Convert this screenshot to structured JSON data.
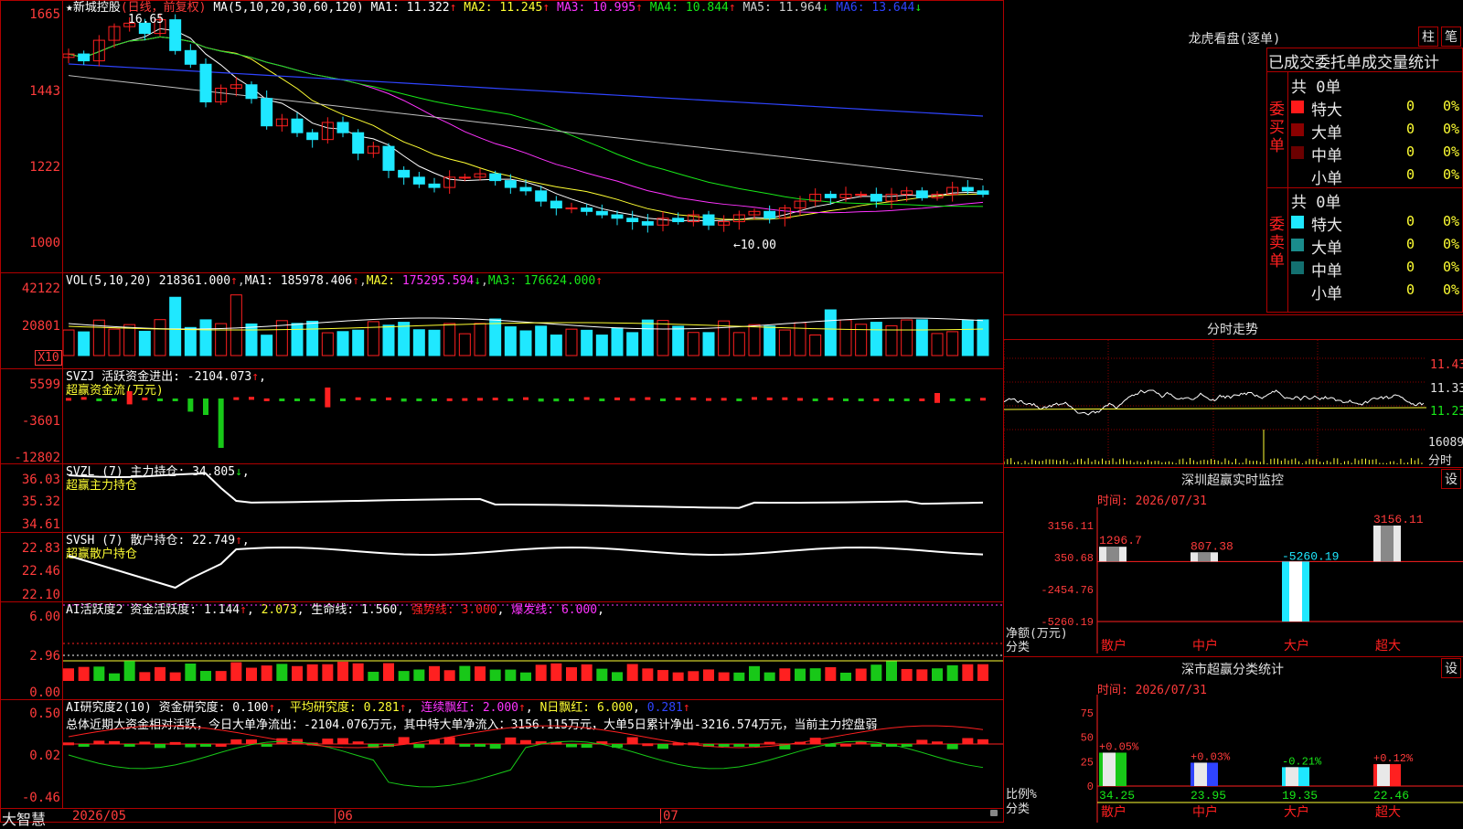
{
  "colors": {
    "up": "#ff2020",
    "down": "#1fe8ff",
    "green": "#18c818",
    "border": "#b00000",
    "axis": "#ff3b3b",
    "yellow": "#ffff33",
    "magenta": "#ff33ff",
    "blue": "#2f44ff",
    "gray": "#c0c0c0"
  },
  "main": {
    "star": "★",
    "title": "新城控股",
    "mode": "(日线，前复权)",
    "ma_label": "MA(5,10,20,30,60,120)",
    "ma": [
      {
        "name": "MA1",
        "val": "11.322",
        "arrow": "↑",
        "color": "#ffffff"
      },
      {
        "name": "MA2",
        "val": "11.245",
        "arrow": "↑",
        "color": "#ffff33"
      },
      {
        "name": "MA3",
        "val": "10.995",
        "arrow": "↑",
        "color": "#ff33ff"
      },
      {
        "name": "MA4",
        "val": "10.844",
        "arrow": "↑",
        "color": "#18e818"
      },
      {
        "name": "MA5",
        "val": "11.964",
        "arrow": "↓",
        "color": "#d0d0d0"
      },
      {
        "name": "MA6",
        "val": "13.644",
        "arrow": "↓",
        "color": "#2f44ff"
      }
    ],
    "high_note": "16.65",
    "low_note": "←10.00",
    "yticks": [
      "1665",
      "1443",
      "1222",
      "1000"
    ]
  },
  "vol": {
    "label": "VOL(5,10,20)",
    "val": "218361.000",
    "ma1": "185978.406",
    "ma2": "175295.594",
    "ma3": "176624.000",
    "arrows": [
      "↑",
      "↑",
      "↓",
      "↑"
    ],
    "yticks": [
      "42122",
      "20801"
    ],
    "unit": "X10"
  },
  "svzj": {
    "label": "SVZJ  活跃资金进出:",
    "val": "-2104.073",
    "sub": "超赢资金流(万元)",
    "yticks": [
      "5599",
      "-3601",
      "-12802"
    ]
  },
  "svzl": {
    "label": "SVZL (7) 主力持仓:",
    "val": "34.805",
    "arrow": "↓",
    "sub": "超赢主力持仓",
    "yticks": [
      "36.03",
      "35.32",
      "34.61"
    ]
  },
  "svsh": {
    "label": "SVSH (7) 散户持仓:",
    "val": "22.749",
    "arrow": "↑",
    "sub": "超赢散户持仓",
    "yticks": [
      "22.83",
      "22.46",
      "22.10"
    ]
  },
  "ai1": {
    "label": "AI活跃度2 资金活跃度:",
    "v1": "1.144",
    "v2": "2.073",
    "life": "生命线:",
    "v3": "1.560",
    "strong": "强势线:",
    "v4": "3.000",
    "burst": "爆发线:",
    "v5": "6.000",
    "yticks": [
      "6.00",
      "2.96",
      "0.00"
    ]
  },
  "ai2": {
    "label": "AI研究度2(10) 资金研究度:",
    "v1": "0.100",
    "avg": "平均研究度:",
    "v2": "0.281",
    "cont": "连续飘红:",
    "v3": "2.000",
    "nday": "N日飘红:",
    "v4": "6.000",
    "v5": "0.281",
    "summary": "总体近期大资金相对活跃，今日大单净流出：-2104.076万元，其中特大单净流入：3156.115万元，大单5日累计净出-3216.574万元，当前主力控盘弱",
    "yticks": [
      "0.50",
      "0.02",
      "-0.46"
    ]
  },
  "footer": {
    "brand": "大智慧",
    "d1": "2026/05",
    "d2": "06",
    "d3": "07"
  },
  "right": {
    "lhb_title": "龙虎看盘(逐单)",
    "btn1": "柱",
    "btn2": "笔",
    "tab_header": "已成交委托单成交量统计",
    "buy_side": "委买单",
    "sell_side": "委卖单",
    "buy_total": "共 0单",
    "sell_total": "共 0单",
    "rows": [
      {
        "label": "特大",
        "count": "0",
        "pct": "0%",
        "color": "#ff1a1a"
      },
      {
        "label": "大单",
        "count": "0",
        "pct": "0%",
        "color": "#8b0000"
      },
      {
        "label": "中单",
        "count": "0",
        "pct": "0%",
        "color": "#6b0000"
      },
      {
        "label": "小单",
        "count": "0",
        "pct": "0%",
        "color": "#000000"
      }
    ],
    "sell_rows": [
      {
        "label": "特大",
        "count": "0",
        "pct": "0%",
        "color": "#1fe8ff"
      },
      {
        "label": "大单",
        "count": "0",
        "pct": "0%",
        "color": "#1a8c8c"
      },
      {
        "label": "中单",
        "count": "0",
        "pct": "0%",
        "color": "#137070"
      },
      {
        "label": "小单",
        "count": "0",
        "pct": "0%",
        "color": "#000000"
      }
    ],
    "fs_title": "分时走势",
    "fs_y": [
      "11.43",
      "11.33",
      "11.23",
      "16089"
    ],
    "fs_unit": "分时",
    "sz_title": "深圳超赢实时监控",
    "sz_btn": "设",
    "time": "时间: 2026/07/31",
    "sz_y": [
      "3156.11",
      "350.68",
      "-2454.76",
      "-5260.19"
    ],
    "sz_axis": "净额(万元)",
    "sz_cat": "分类",
    "sz_bars": [
      {
        "name": "散户",
        "val": "1296.7"
      },
      {
        "name": "中户",
        "val": "807.38"
      },
      {
        "name": "大户",
        "val": "-5260.19"
      },
      {
        "name": "超大",
        "val": "3156.11"
      }
    ],
    "fl_title": "深市超赢分类统计",
    "fl_btn": "设",
    "fl_y": [
      "75",
      "50",
      "25",
      "0"
    ],
    "fl_axis": "比例%",
    "fl_cat": "分类",
    "fl_bars": [
      {
        "name": "散户",
        "val": "34.25",
        "chg": "+0.05%",
        "color": "#18c818"
      },
      {
        "name": "中户",
        "val": "23.95",
        "chg": "+0.03%",
        "color": "#2f44ff"
      },
      {
        "name": "大户",
        "val": "19.35",
        "chg": "-0.21%",
        "color": "#1fe8ff"
      },
      {
        "name": "超大",
        "val": "22.46",
        "chg": "+0.12%",
        "color": "#ff2020"
      }
    ]
  }
}
